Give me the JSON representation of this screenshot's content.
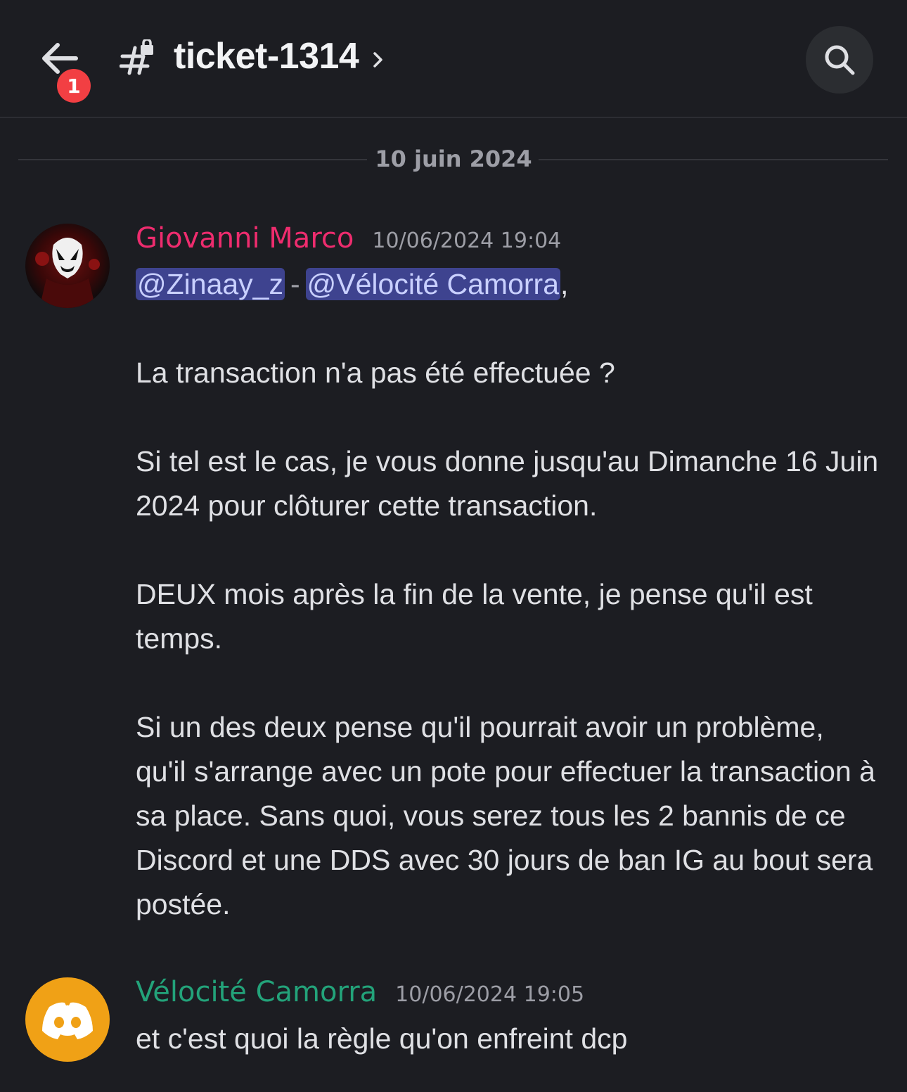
{
  "header": {
    "back_badge_count": "1",
    "channel_name": "ticket-1314"
  },
  "date_divider": "10 juin 2024",
  "messages": [
    {
      "author": "Giovanni Marco",
      "timestamp": "10/06/2024 19:04",
      "mention1": "@Zinaay_z",
      "separator": "-",
      "mention2": "@Vélocité Camorra",
      "after_mentions": ",",
      "paragraphs": [
        "La transaction n'a pas été effectuée ?",
        "Si tel est le cas, je vous donne jusqu'au Dimanche 16 Juin 2024 pour clôturer cette transaction.",
        "DEUX mois après la fin de la vente, je pense qu'il est temps.",
        "Si un des deux pense qu'il pourrait avoir un problème, qu'il s'arrange avec un pote pour effectuer la transaction à sa place. Sans quoi, vous serez tous les 2 bannis de ce Discord et une DDS avec 30 jours de ban IG au bout sera postée."
      ]
    },
    {
      "author": "Vélocité Camorra",
      "timestamp": "10/06/2024 19:05",
      "text": "et c'est quoi la règle qu'on enfreint dcp"
    }
  ],
  "colors": {
    "background": "#1c1d22",
    "author1": "#ee2c6e",
    "author2": "#23a37a",
    "mention_bg": "#3e438f",
    "badge": "#f23f43",
    "avatar2_bg": "#f0a116"
  }
}
